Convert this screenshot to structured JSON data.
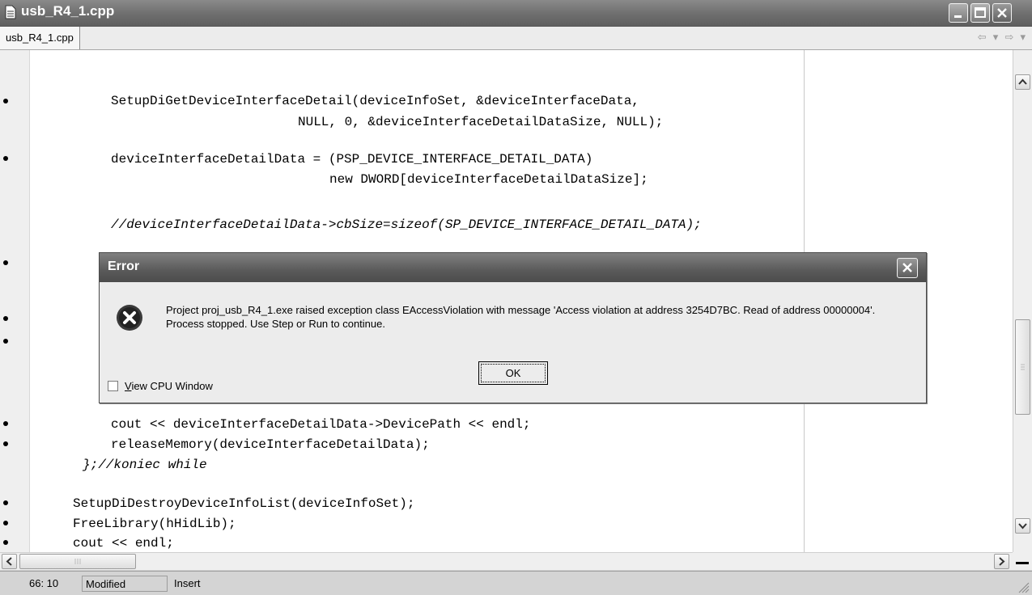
{
  "window": {
    "title": "usb_R4_1.cpp"
  },
  "tabs": [
    {
      "label": "usb_R4_1.cpp"
    }
  ],
  "nav": {
    "back_symbol": "⇦ ▾",
    "forward_symbol": "⇨ ▾"
  },
  "editor": {
    "lines": [
      "SetupDiGetDeviceInterfaceDetail(deviceInfoSet, &deviceInterfaceData,",
      "NULL, 0, &deviceInterfaceDetailDataSize, NULL);",
      "deviceInterfaceDetailData = (PSP_DEVICE_INTERFACE_DETAIL_DATA)",
      "new DWORD[deviceInterfaceDetailDataSize];",
      "//deviceInterfaceDetailData->cbSize=sizeof(SP_DEVICE_INTERFACE_DETAIL_DATA);",
      "cout << deviceInterfaceDetailData->DevicePath << endl;",
      "releaseMemory(deviceInterfaceDetailData);",
      "};//koniec while",
      "SetupDiDestroyDeviceInfoList(deviceInfoSet);",
      "FreeLibrary(hHidLib);",
      "cout << endl;"
    ]
  },
  "status": {
    "position": "66: 10",
    "modified": "Modified",
    "mode": "Insert"
  },
  "dialog": {
    "title": "Error",
    "message": "Project proj_usb_R4_1.exe raised exception class EAccessViolation with message 'Access violation at address 3254D7BC. Read of address 00000004'. Process stopped. Use Step or Run to continue.",
    "ok_label": "OK",
    "checkbox_label_first": "V",
    "checkbox_label_rest": "iew CPU Window",
    "checkbox_checked": false
  },
  "colors": {
    "title_bar": "#6e6e6e",
    "editor_bg": "#ffffff",
    "dialog_bg": "#ececec"
  },
  "icons": [
    "document-icon",
    "minimize-icon",
    "maximize-icon",
    "close-icon",
    "error-icon",
    "scroll-up-icon",
    "scroll-down-icon",
    "scroll-left-icon",
    "scroll-right-icon"
  ]
}
